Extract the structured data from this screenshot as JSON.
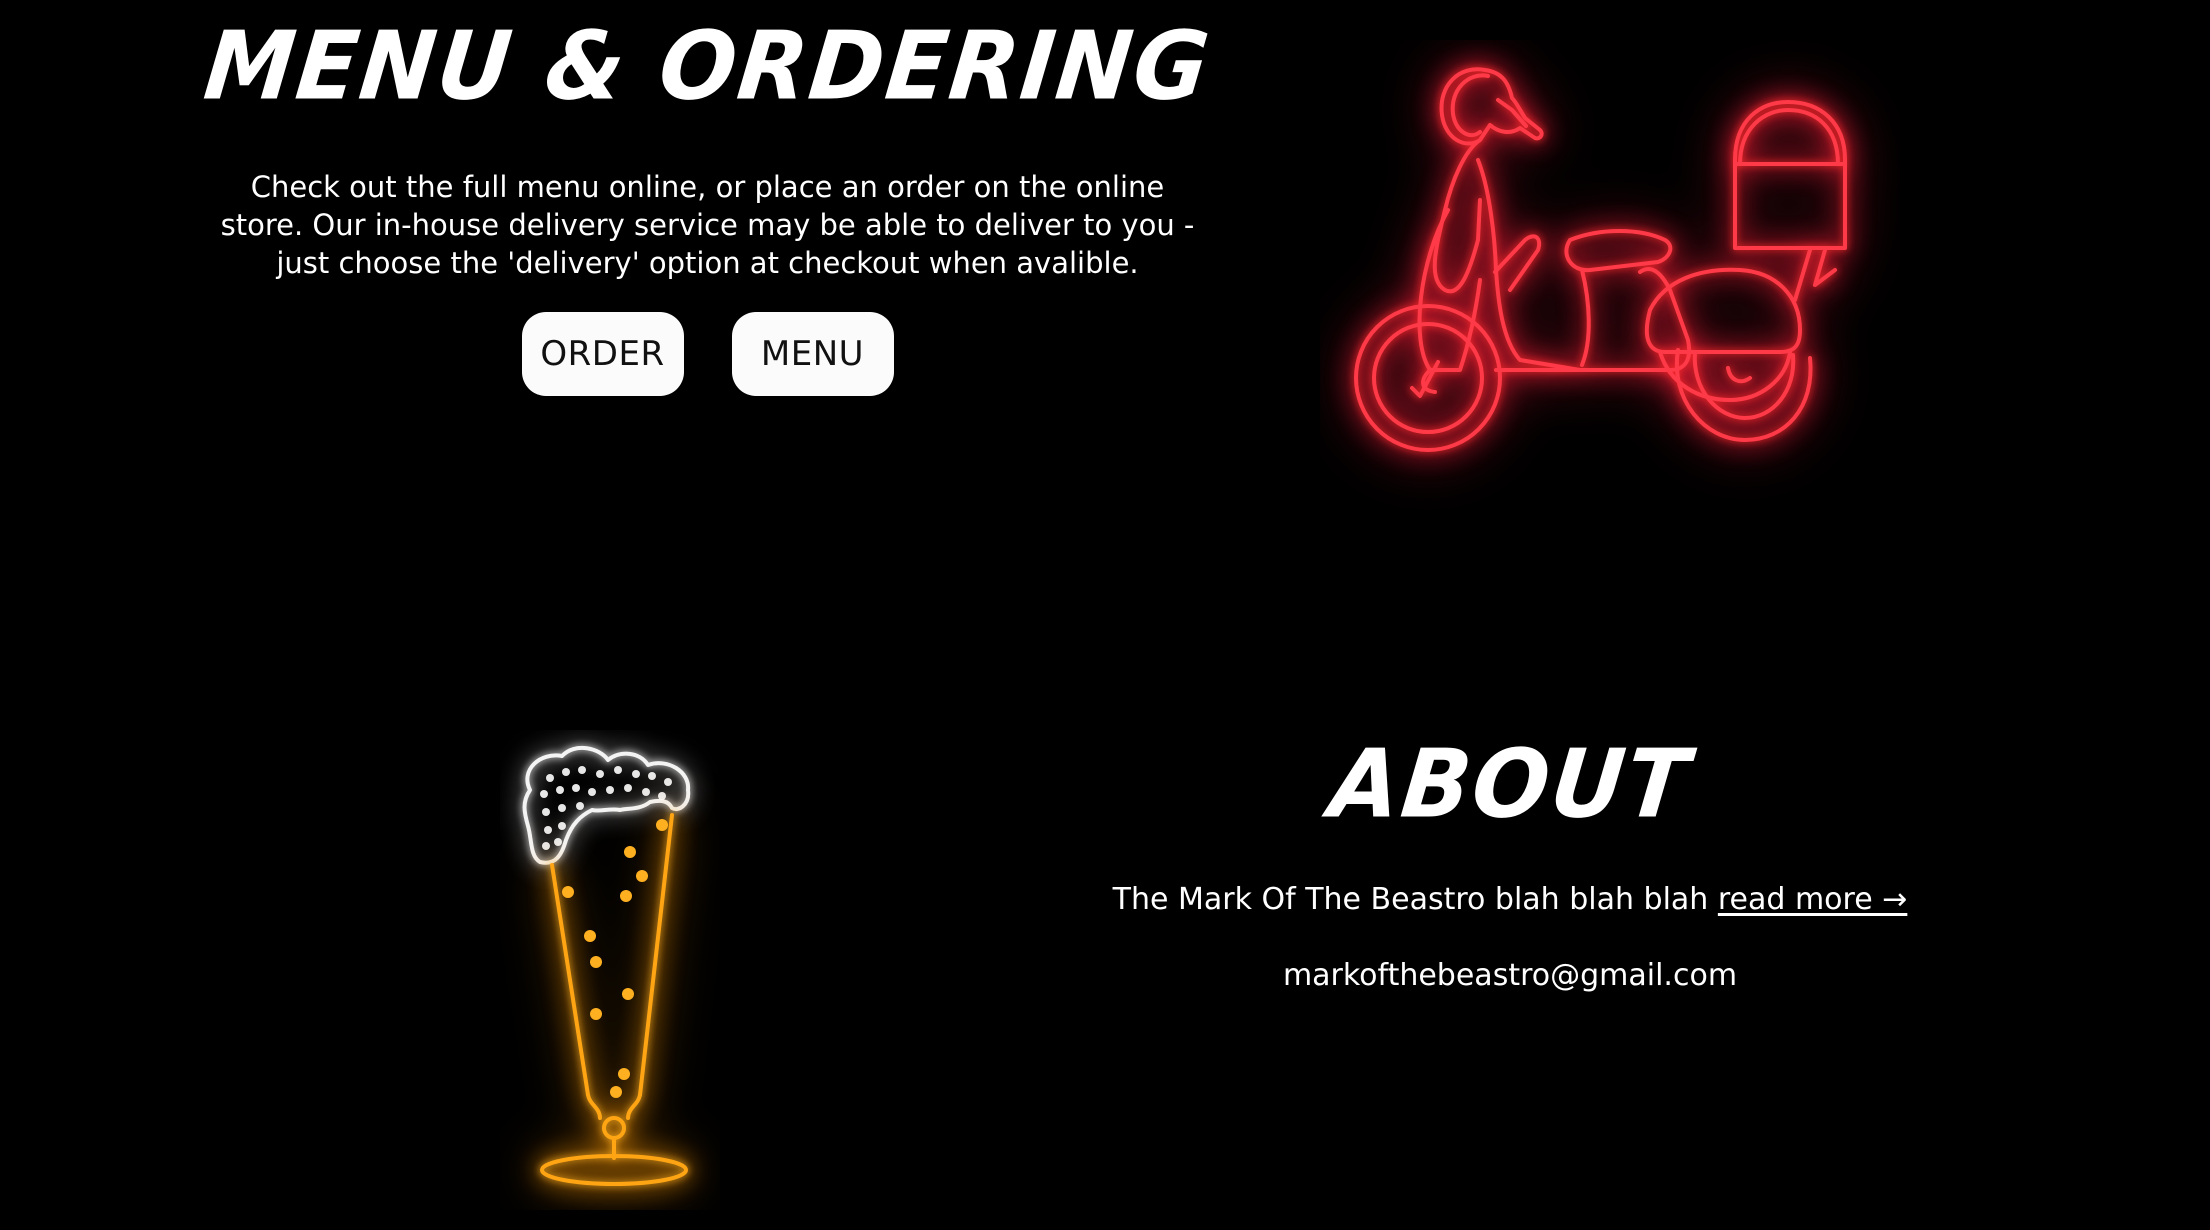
{
  "menu": {
    "title": "MENU & ORDERING",
    "description": "Check out the full menu online, or place an order on the online store. Our in-house delivery service may be able to deliver to you - just choose the 'delivery' option at checkout when avalible.",
    "order_button": "ORDER",
    "menu_button": "MENU"
  },
  "about": {
    "title": "ABOUT",
    "text": "The Mark Of The Beastro blah blah blah ",
    "read_more": "read more →",
    "email": "markofthebeastro@gmail.com"
  },
  "icons": {
    "scooter": "neon-delivery-scooter-icon",
    "beer": "neon-beer-glass-icon"
  },
  "colors": {
    "background": "#000000",
    "text": "#ffffff",
    "button_bg": "#fbfbfb",
    "neon_red": "#ff2a3a",
    "neon_amber": "#ffa514",
    "neon_white": "#f4f4f4"
  }
}
